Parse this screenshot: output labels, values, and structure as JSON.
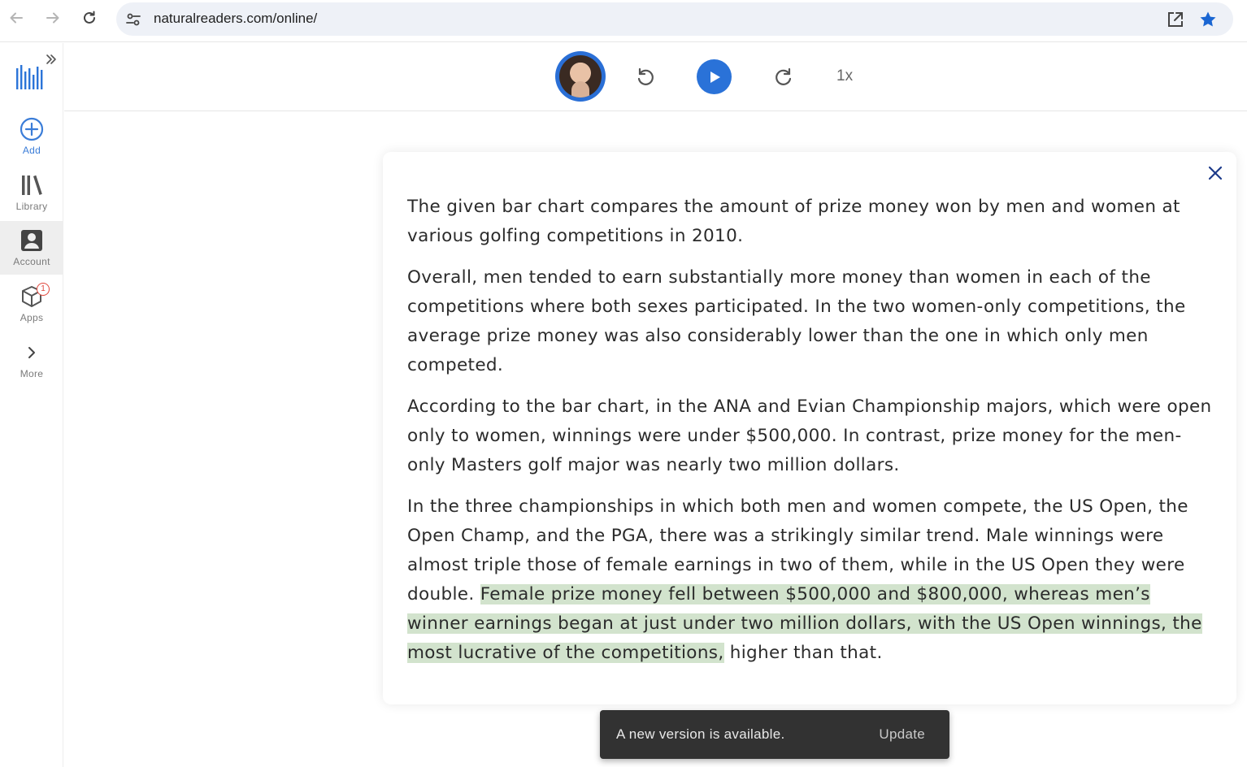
{
  "browser": {
    "url": "naturalreaders.com/online/"
  },
  "sidebar": {
    "items": [
      {
        "label": "Add"
      },
      {
        "label": "Library"
      },
      {
        "label": "Account"
      },
      {
        "label": "Apps"
      },
      {
        "label": "More"
      }
    ],
    "apps_badge": "1"
  },
  "player": {
    "speed": "1x"
  },
  "document": {
    "paragraphs": [
      "The given bar chart compares the amount of prize money won by men and women at various golfing competitions in 2010.",
      "Overall, men tended to earn substantially more money than women in each of the competitions where both sexes participated. In the two women-only competitions, the average prize money was also considerably lower than the one in which only men competed.",
      "According to the bar chart, in the ANA and Evian Championship majors, which were open only to women, winnings were under $500,000. In contrast, prize money for the men-only Masters golf major was nearly two million dollars."
    ],
    "last_paragraph": {
      "before": "In the three championships in which both men and women compete, the US Open, the Open Champ, and the PGA, there was a strikingly similar trend. Male winnings were almost triple those of female earnings in two of them, while in the US Open they were double. ",
      "highlighted": "Female prize money fell between $500,000 and $800,000, whereas men’s winner earnings began at just under two million dollars, with the US Open winnings, the most lucrative of the competitions,",
      "after": " higher than that."
    }
  },
  "toast": {
    "message": "A new version is available.",
    "action": "Update"
  },
  "colors": {
    "accent": "#2a72d8",
    "highlight": "#d2e3cd",
    "toast_bg": "#323232"
  }
}
